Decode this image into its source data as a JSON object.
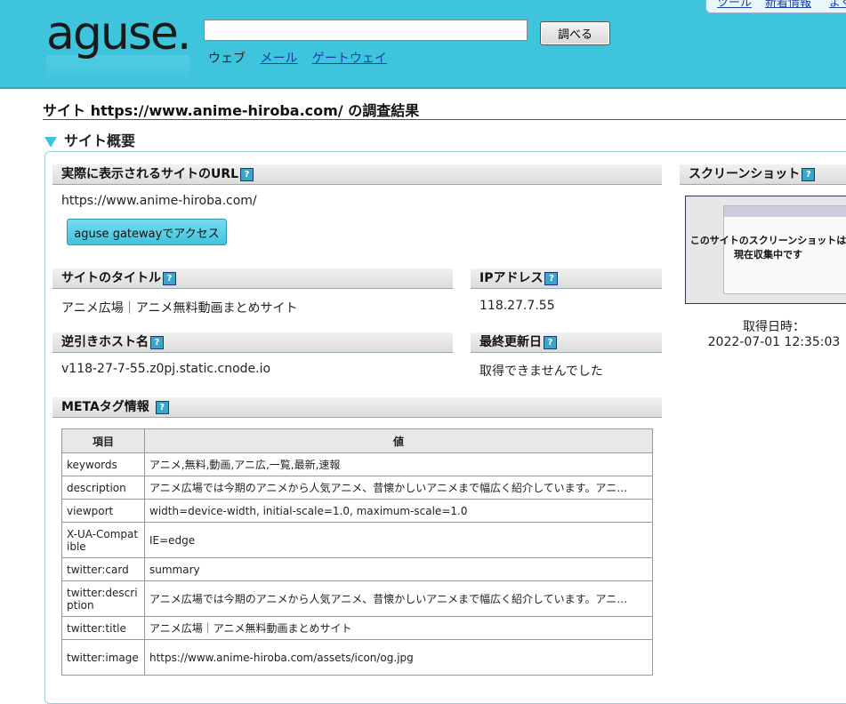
{
  "header": {
    "logo": "aguse.",
    "search_placeholder": "",
    "search_button": "調べる",
    "tabs": [
      "ウェブ",
      "メール",
      "ゲートウェイ"
    ],
    "top_links": [
      "ツール",
      "新着情報",
      "よく"
    ]
  },
  "page": {
    "title": "サイト https://www.anime-hiroba.com/ の調査結果",
    "section": "サイト概要"
  },
  "url_block": {
    "heading": "実際に表示されるサイトのURL",
    "value": "https://www.anime-hiroba.com/",
    "button": "aguse gatewayでアクセス"
  },
  "site_title": {
    "heading": "サイトのタイトル",
    "value": "アニメ広場｜アニメ無料動画まとめサイト"
  },
  "ip": {
    "heading": "IPアドレス",
    "value": "118.27.7.55"
  },
  "reverse_host": {
    "heading": "逆引きホスト名",
    "value": "v118-27-7-55.z0pj.static.cnode.io"
  },
  "last_update": {
    "heading": "最終更新日",
    "value": "取得できませんでした"
  },
  "screenshot": {
    "heading": "スクリーンショット",
    "placeholder_line1": "このサイトのスクリーンショットは",
    "placeholder_line2": "現在収集中です",
    "caption_label": "取得日時：",
    "caption_value": "2022-07-01 12:35:03"
  },
  "meta": {
    "heading": "METAタグ情報",
    "col_key": "項目",
    "col_val": "値",
    "rows": [
      {
        "k": "keywords",
        "v": "アニメ,無料,動画,アニ広,一覧,最新,速報"
      },
      {
        "k": "description",
        "v": "アニメ広場では今期のアニメから人気アニメ、昔懐かしいアニメまで幅広く紹介しています。アニ…"
      },
      {
        "k": "viewport",
        "v": "width=device-width, initial-scale=1.0, maximum-scale=1.0"
      },
      {
        "k": "X-UA-Compatible",
        "v": "IE=edge"
      },
      {
        "k": "twitter:card",
        "v": "summary"
      },
      {
        "k": "twitter:description",
        "v": "アニメ広場では今期のアニメから人気アニメ、昔懐かしいアニメまで幅広く紹介しています。アニ…"
      },
      {
        "k": "twitter:title",
        "v": "アニメ広場｜アニメ無料動画まとめサイト"
      },
      {
        "k": "twitter:image",
        "v": "https://www.anime-hiroba.com/assets/icon/og.jpg"
      }
    ]
  },
  "help_mark": "?",
  "colors": {
    "header_bg": "#3ec4dc",
    "link": "#1a3fa8"
  }
}
